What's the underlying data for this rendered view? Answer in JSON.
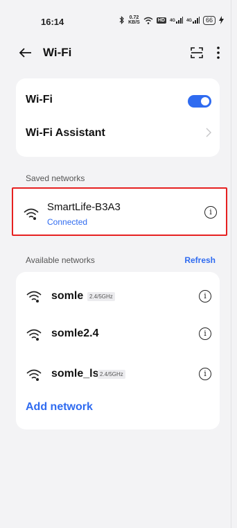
{
  "status_bar": {
    "time": "16:14",
    "speed_value": "0.72",
    "speed_unit": "KB/S",
    "hd": "HD",
    "sig1_label": "4G",
    "sig2_label": "4G",
    "battery": "66"
  },
  "header": {
    "title": "Wi-Fi"
  },
  "wifi_card": {
    "wifi_label": "Wi-Fi",
    "wifi_enabled": true,
    "assistant_label": "Wi-Fi Assistant"
  },
  "saved": {
    "section_label": "Saved networks",
    "network_name": "SmartLife-B3A3",
    "network_status": "Connected"
  },
  "available": {
    "section_label": "Available networks",
    "refresh_label": "Refresh",
    "networks": [
      {
        "name": "somle",
        "band": "2.4/5GHz"
      },
      {
        "name": "somle2.4",
        "band": ""
      },
      {
        "name": "somle_ls",
        "band": "2.4/5GHz"
      }
    ],
    "add_label": "Add network"
  },
  "colors": {
    "accent": "#2f6bf0",
    "highlight_border": "#e62020",
    "background": "#f3f3f5"
  }
}
